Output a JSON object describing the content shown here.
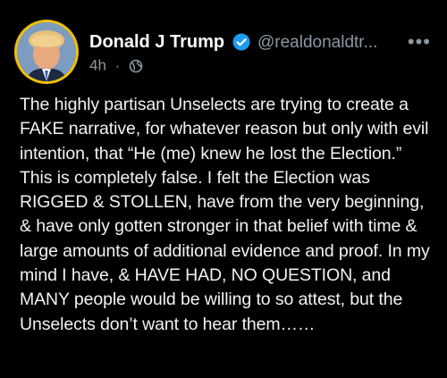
{
  "post": {
    "author_name": "Donald J Trump",
    "handle": "@realdonaldtr...",
    "time": "4h",
    "separator": "·",
    "more_label": "•••",
    "text": "The highly partisan Unselects are trying to create a FAKE narrative, for whatever reason but only with evil intention, that “He (me) knew he lost the Election.” This is completely false. I felt the Election was RIGGED & STOLLEN, have from the very beginning, & have only gotten stronger in that belief with time & large amounts of additional evidence and proof. In my mind I have, & HAVE HAD, NO QUESTION, and MANY people would be willing to so attest, but the Unselects don’t want to hear them……"
  },
  "icons": {
    "verified": "verified-badge-icon",
    "visibility": "globe-icon",
    "more": "more-options-icon"
  },
  "colors": {
    "background": "#000000",
    "text": "#e7e9ea",
    "secondary": "#8b98a5",
    "verified": "#1d9bf0",
    "avatar_ring": "#f2c200"
  }
}
